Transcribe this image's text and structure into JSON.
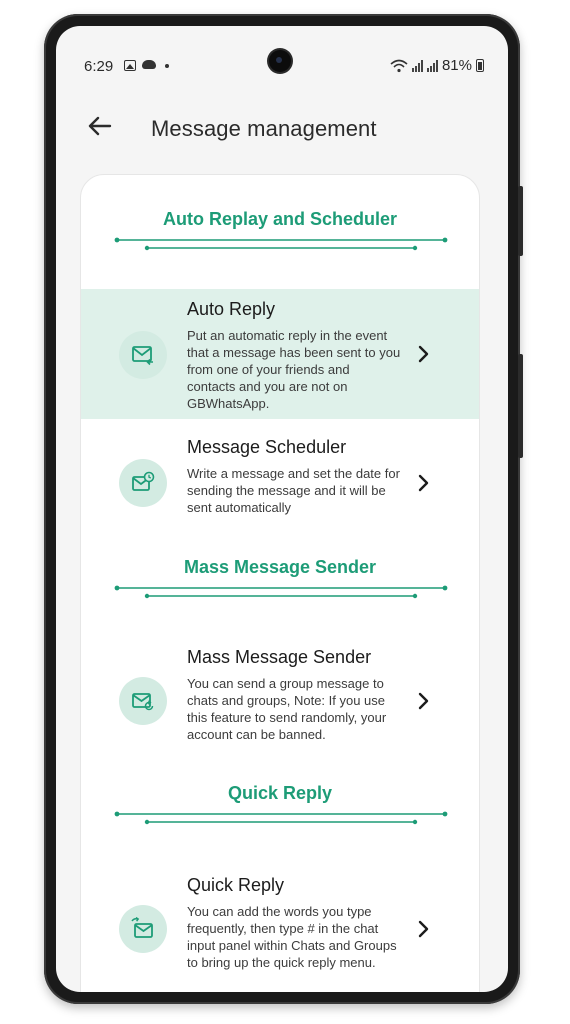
{
  "status_bar": {
    "time": "6:29",
    "battery": "81%"
  },
  "header": {
    "title": "Message management"
  },
  "sections": [
    {
      "title": "Auto Replay and Scheduler"
    },
    {
      "title": "Mass Message Sender"
    },
    {
      "title": "Quick Reply"
    }
  ],
  "items": [
    {
      "title": "Auto Reply",
      "description": "Put an automatic reply in the event that a message has been sent to you from one of your friends and contacts and you are not on GBWhatsApp.",
      "icon": "mail-reply-icon"
    },
    {
      "title": "Message Scheduler",
      "description": "Write a message and set the date for sending the message and it will be sent automatically",
      "icon": "mail-clock-icon"
    },
    {
      "title": "Mass Message Sender",
      "description": "You can send a group message to chats and groups, Note: If you use this feature to send randomly, your account can be banned.",
      "icon": "mail-refresh-icon"
    },
    {
      "title": "Quick Reply",
      "description": "You can add the words you type frequently, then type # in the chat input panel within Chats and Groups to bring up the quick reply menu.",
      "icon": "mail-quick-icon"
    }
  ],
  "colors": {
    "accent": "#1d9c77",
    "highlight": "#dff1ea",
    "icon_bg": "#d3ebe2"
  }
}
